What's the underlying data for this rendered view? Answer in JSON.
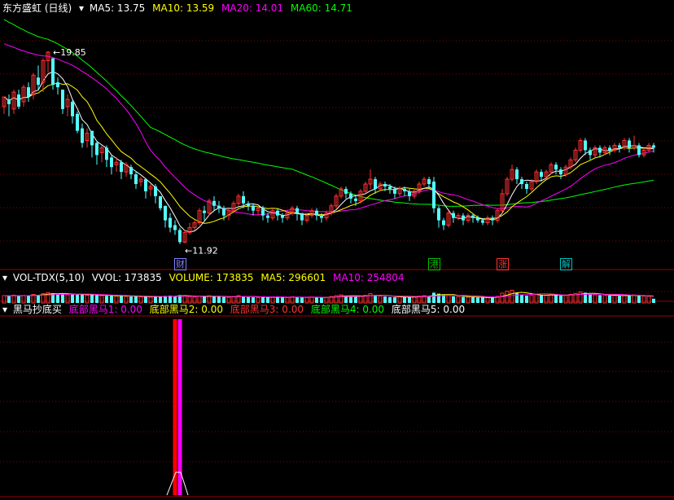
{
  "colors": {
    "bg": "#000000",
    "up": "#ff3232",
    "down": "#54ffff",
    "ma5": "#ffffff",
    "ma10": "#ffff00",
    "ma20": "#ff00ff",
    "ma60": "#00ff00",
    "grid": "#8b0000",
    "sep": "#a00000"
  },
  "main_header": {
    "title": "东方盛虹 (日线)",
    "ma5": "MA5: 13.75",
    "ma10": "MA10: 13.59",
    "ma20": "MA20: 14.01",
    "ma60": "MA60: 14.71"
  },
  "vol_header": {
    "title": "VOL-TDX(5,10)",
    "vvol": "VVOL: 173835",
    "volume": "VOLUME: 173835",
    "ma5": "MA5: 296601",
    "ma10": "MA10: 254804"
  },
  "ind_header": {
    "title": "黑马抄底买",
    "s1": "底部黑马1: 0.00",
    "s2": "底部黑马2: 0.00",
    "s3": "底部黑马3: 0.00",
    "s4": "底部黑马4: 0.00",
    "s5": "底部黑马5: 0.00"
  },
  "annotations": {
    "high": "19.85",
    "low": "11.92"
  },
  "markers": [
    {
      "text": "财",
      "index": 36
    },
    {
      "text": "港",
      "index": 88
    },
    {
      "text": "涨",
      "index": 102
    },
    {
      "text": "解",
      "index": 115
    }
  ],
  "chart_data": [
    {
      "type": "candlestick",
      "name": "东方盛虹 (日线)",
      "ylim": [
        10.9,
        21.4
      ],
      "high_label": 19.85,
      "low_label": 11.92,
      "candles": [
        [
          17.6,
          18.0,
          17.3,
          18.0
        ],
        [
          17.9,
          17.7,
          17.2,
          18.1
        ],
        [
          17.5,
          18.2,
          17.3,
          18.3
        ],
        [
          18.1,
          17.6,
          17.5,
          18.3
        ],
        [
          17.8,
          18.4,
          17.6,
          18.5
        ],
        [
          18.4,
          18.0,
          17.8,
          18.6
        ],
        [
          18.1,
          18.9,
          17.9,
          19.0
        ],
        [
          18.8,
          18.5,
          18.3,
          19.3
        ],
        [
          18.6,
          19.5,
          18.2,
          19.6
        ],
        [
          19.5,
          19.85,
          19.0,
          19.9
        ],
        [
          19.6,
          18.5,
          18.3,
          19.6
        ],
        [
          18.6,
          18.4,
          18.1,
          18.8
        ],
        [
          18.3,
          17.5,
          17.3,
          18.3
        ],
        [
          17.6,
          17.9,
          17.2,
          18.1
        ],
        [
          17.8,
          17.2,
          16.9,
          17.9
        ],
        [
          17.3,
          16.6,
          16.5,
          17.4
        ],
        [
          16.7,
          16.1,
          15.9,
          16.9
        ],
        [
          16.2,
          16.5,
          15.9,
          16.7
        ],
        [
          16.6,
          16.0,
          15.5,
          16.6
        ],
        [
          16.1,
          15.6,
          15.2,
          16.2
        ],
        [
          15.7,
          15.9,
          15.3,
          16.0
        ],
        [
          15.9,
          15.4,
          15.1,
          16.0
        ],
        [
          15.5,
          15.1,
          14.8,
          15.6
        ],
        [
          15.2,
          15.3,
          14.9,
          15.5
        ],
        [
          15.3,
          14.9,
          14.6,
          15.4
        ],
        [
          14.9,
          15.2,
          14.7,
          15.3
        ],
        [
          15.1,
          14.8,
          14.6,
          15.2
        ],
        [
          14.8,
          14.4,
          14.2,
          14.9
        ],
        [
          14.5,
          14.6,
          14.3,
          14.7
        ],
        [
          14.6,
          14.1,
          13.8,
          14.6
        ],
        [
          14.2,
          14.3,
          13.9,
          14.4
        ],
        [
          14.3,
          13.9,
          13.6,
          14.4
        ],
        [
          13.9,
          13.4,
          13.3,
          13.9
        ],
        [
          13.5,
          12.9,
          12.6,
          13.5
        ],
        [
          13.0,
          12.6,
          12.4,
          13.2
        ],
        [
          12.7,
          12.5,
          12.3,
          12.9
        ],
        [
          12.5,
          12.0,
          11.92,
          12.6
        ],
        [
          12.0,
          12.4,
          11.95,
          12.5
        ],
        [
          12.4,
          12.6,
          12.3,
          12.8
        ],
        [
          12.6,
          12.8,
          12.5,
          12.9
        ],
        [
          12.8,
          13.3,
          12.7,
          13.4
        ],
        [
          13.3,
          13.2,
          12.9,
          13.5
        ],
        [
          13.2,
          13.7,
          13.1,
          13.8
        ],
        [
          13.7,
          13.5,
          13.3,
          13.9
        ],
        [
          13.5,
          13.4,
          13.2,
          13.7
        ],
        [
          13.4,
          13.1,
          12.9,
          13.5
        ],
        [
          13.1,
          13.3,
          12.9,
          13.4
        ],
        [
          13.3,
          13.6,
          13.2,
          13.7
        ],
        [
          13.6,
          13.9,
          13.5,
          14.0
        ],
        [
          13.9,
          13.6,
          13.4,
          14.1
        ],
        [
          13.6,
          13.5,
          13.3,
          13.7
        ],
        [
          13.5,
          13.3,
          13.1,
          13.6
        ],
        [
          13.3,
          13.4,
          13.1,
          13.5
        ],
        [
          13.4,
          13.1,
          12.9,
          13.5
        ],
        [
          13.1,
          13.0,
          12.8,
          13.2
        ],
        [
          13.0,
          13.3,
          12.9,
          13.4
        ],
        [
          13.3,
          13.1,
          12.9,
          13.4
        ],
        [
          13.1,
          13.0,
          12.8,
          13.2
        ],
        [
          13.0,
          13.2,
          12.9,
          13.3
        ],
        [
          13.2,
          13.4,
          13.1,
          13.5
        ],
        [
          13.4,
          13.2,
          12.9,
          13.5
        ],
        [
          13.2,
          12.9,
          12.7,
          13.2
        ],
        [
          12.9,
          13.1,
          12.8,
          13.2
        ],
        [
          13.1,
          13.3,
          13.0,
          13.4
        ],
        [
          13.3,
          13.1,
          12.9,
          13.4
        ],
        [
          13.1,
          13.0,
          12.8,
          13.2
        ],
        [
          13.0,
          13.2,
          12.9,
          13.3
        ],
        [
          13.2,
          13.5,
          13.1,
          13.6
        ],
        [
          13.5,
          13.9,
          13.4,
          14.0
        ],
        [
          13.9,
          14.2,
          13.8,
          14.3
        ],
        [
          14.2,
          14.0,
          13.8,
          14.3
        ],
        [
          14.0,
          13.8,
          13.6,
          14.1
        ],
        [
          13.8,
          13.7,
          13.5,
          13.9
        ],
        [
          13.7,
          14.1,
          13.6,
          14.2
        ],
        [
          14.1,
          14.4,
          14.0,
          14.5
        ],
        [
          14.4,
          14.6,
          14.2,
          15.0
        ],
        [
          14.6,
          14.2,
          14.0,
          14.7
        ],
        [
          14.2,
          14.4,
          14.1,
          14.5
        ],
        [
          14.4,
          14.3,
          14.1,
          14.5
        ],
        [
          14.3,
          14.2,
          14.0,
          14.4
        ],
        [
          14.2,
          14.0,
          13.8,
          14.3
        ],
        [
          14.0,
          14.2,
          13.9,
          14.3
        ],
        [
          14.2,
          14.1,
          13.9,
          14.3
        ],
        [
          14.1,
          13.9,
          13.7,
          14.2
        ],
        [
          13.9,
          14.1,
          13.8,
          14.2
        ],
        [
          14.1,
          14.4,
          14.0,
          14.5
        ],
        [
          14.4,
          14.6,
          14.3,
          14.7
        ],
        [
          14.6,
          14.4,
          14.2,
          14.7
        ],
        [
          14.5,
          13.4,
          13.2,
          14.7
        ],
        [
          13.4,
          12.9,
          12.6,
          13.5
        ],
        [
          12.9,
          12.7,
          12.5,
          13.0
        ],
        [
          12.7,
          13.2,
          12.6,
          13.3
        ],
        [
          13.2,
          13.0,
          12.8,
          13.3
        ],
        [
          13.0,
          13.1,
          12.9,
          13.2
        ],
        [
          13.1,
          12.9,
          12.7,
          13.2
        ],
        [
          12.9,
          13.1,
          12.8,
          13.2
        ],
        [
          13.1,
          13.0,
          12.8,
          13.2
        ],
        [
          13.0,
          12.9,
          12.8,
          13.1
        ],
        [
          12.9,
          12.8,
          12.7,
          13.0
        ],
        [
          12.8,
          13.0,
          12.7,
          13.1
        ],
        [
          13.0,
          12.9,
          12.7,
          13.1
        ],
        [
          12.9,
          13.3,
          12.8,
          13.4
        ],
        [
          13.3,
          14.0,
          13.2,
          14.2
        ],
        [
          14.0,
          14.6,
          13.9,
          14.7
        ],
        [
          14.6,
          15.0,
          14.5,
          15.2
        ],
        [
          15.0,
          14.6,
          14.4,
          15.1
        ],
        [
          14.6,
          14.4,
          14.2,
          14.7
        ],
        [
          14.4,
          14.2,
          14.0,
          14.5
        ],
        [
          14.2,
          14.5,
          14.1,
          14.6
        ],
        [
          14.5,
          14.9,
          14.4,
          15.0
        ],
        [
          14.9,
          14.7,
          14.5,
          15.0
        ],
        [
          14.7,
          14.9,
          14.6,
          15.0
        ],
        [
          14.9,
          15.2,
          14.8,
          15.3
        ],
        [
          15.2,
          15.0,
          14.8,
          15.3
        ],
        [
          15.0,
          14.8,
          14.6,
          15.1
        ],
        [
          14.8,
          15.1,
          14.7,
          15.2
        ],
        [
          15.1,
          15.4,
          15.0,
          15.5
        ],
        [
          15.4,
          15.8,
          15.3,
          15.9
        ],
        [
          15.8,
          16.2,
          15.7,
          16.3
        ],
        [
          16.2,
          15.8,
          15.6,
          16.3
        ],
        [
          15.8,
          15.6,
          15.4,
          15.9
        ],
        [
          15.6,
          15.9,
          15.5,
          16.0
        ],
        [
          15.9,
          15.7,
          15.5,
          16.0
        ],
        [
          15.7,
          15.9,
          15.6,
          16.0
        ],
        [
          15.9,
          15.8,
          15.6,
          16.0
        ],
        [
          15.8,
          16.0,
          15.7,
          16.1
        ],
        [
          16.0,
          15.9,
          15.7,
          16.1
        ],
        [
          15.9,
          16.2,
          15.8,
          16.3
        ],
        [
          16.2,
          15.9,
          15.7,
          16.3
        ],
        [
          15.9,
          16.0,
          15.8,
          16.4
        ],
        [
          16.0,
          15.6,
          15.5,
          16.1
        ],
        [
          15.6,
          15.8,
          15.5,
          15.9
        ],
        [
          15.8,
          16.0,
          15.7,
          16.1
        ],
        [
          16.0,
          15.9,
          15.7,
          16.1
        ]
      ]
    },
    {
      "type": "bar",
      "name": "VOL-TDX(5,10)",
      "ylim": [
        0,
        800000
      ],
      "volumes": [
        300000,
        280000,
        320000,
        290000,
        310000,
        300000,
        350000,
        330000,
        380000,
        420000,
        400000,
        360000,
        380000,
        340000,
        350000,
        330000,
        360000,
        320000,
        340000,
        310000,
        300000,
        290000,
        310000,
        280000,
        300000,
        270000,
        260000,
        280000,
        250000,
        260000,
        240000,
        250000,
        270000,
        290000,
        300000,
        280000,
        320000,
        300000,
        260000,
        240000,
        280000,
        260000,
        300000,
        270000,
        250000,
        240000,
        230000,
        260000,
        300000,
        280000,
        240000,
        230000,
        220000,
        240000,
        230000,
        250000,
        240000,
        230000,
        220000,
        250000,
        240000,
        230000,
        220000,
        240000,
        230000,
        220000,
        230000,
        260000,
        300000,
        330000,
        300000,
        270000,
        250000,
        280000,
        310000,
        380000,
        320000,
        280000,
        260000,
        240000,
        230000,
        250000,
        240000,
        230000,
        250000,
        280000,
        300000,
        290000,
        420000,
        380000,
        330000,
        300000,
        270000,
        260000,
        250000,
        240000,
        230000,
        220000,
        230000,
        220000,
        230000,
        270000,
        400000,
        480000,
        520000,
        420000,
        350000,
        300000,
        310000,
        350000,
        330000,
        310000,
        340000,
        320000,
        300000,
        310000,
        350000,
        390000,
        450000,
        420000,
        360000,
        340000,
        320000,
        310000,
        300000,
        310000,
        290000,
        300000,
        310000,
        330000,
        300000,
        280000,
        270000,
        173835
      ]
    },
    {
      "type": "bar",
      "name": "黑马抄底买",
      "series": [
        {
          "name": "底部黑马1",
          "index": 35,
          "value": 1
        },
        {
          "name": "底部黑马2",
          "index": 36,
          "value": 1
        }
      ]
    }
  ]
}
